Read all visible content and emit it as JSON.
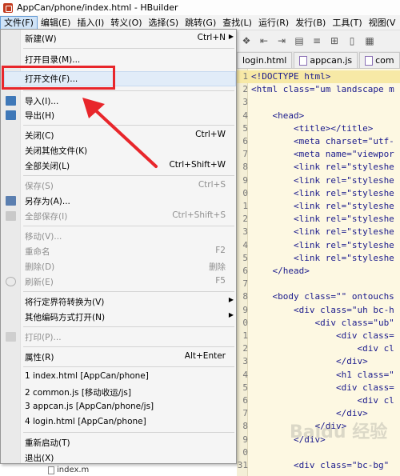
{
  "window": {
    "title": "AppCan/phone/index.html - HBuilder"
  },
  "menubar": [
    "文件(F)",
    "编辑(E)",
    "插入(I)",
    "转义(O)",
    "选择(S)",
    "跳转(G)",
    "查找(L)",
    "运行(R)",
    "发行(B)",
    "工具(T)",
    "视图(V"
  ],
  "tabs": [
    "login.html",
    "appcan.js",
    "com"
  ],
  "menu": {
    "new": {
      "label": "新建(W)",
      "shortcut": "Ctrl+N"
    },
    "open_dir": {
      "label": "打开目录(M)..."
    },
    "open_file": {
      "label": "打开文件(F)..."
    },
    "import": {
      "label": "导入(I)..."
    },
    "export": {
      "label": "导出(H)"
    },
    "close": {
      "label": "关闭(C)",
      "shortcut": "Ctrl+W"
    },
    "close_others": {
      "label": "关闭其他文件(K)"
    },
    "close_all": {
      "label": "全部关闭(L)",
      "shortcut": "Ctrl+Shift+W"
    },
    "save": {
      "label": "保存(S)",
      "shortcut": "Ctrl+S"
    },
    "save_as": {
      "label": "另存为(A)..."
    },
    "save_all": {
      "label": "全部保存(I)",
      "shortcut": "Ctrl+Shift+S"
    },
    "move": {
      "label": "移动(V)..."
    },
    "rename": {
      "label": "重命名",
      "shortcut": "F2"
    },
    "delete": {
      "label": "删除(D)",
      "shortcut": "删除"
    },
    "refresh": {
      "label": "刷新(E)",
      "shortcut": "F5"
    },
    "convert_eol": {
      "label": "将行定界符转换为(V)"
    },
    "open_encoding": {
      "label": "其他编码方式打开(N)"
    },
    "print": {
      "label": "打印(P)..."
    },
    "properties": {
      "label": "属性(R)",
      "shortcut": "Alt+Enter"
    },
    "recent": [
      "1 index.html  [AppCan/phone]",
      "2 common.js  [移动收运/js]",
      "3 appcan.js  [AppCan/phone/js]",
      "4 login.html  [AppCan/phone]"
    ],
    "restart": {
      "label": "重新启动(T)"
    },
    "exit": {
      "label": "退出(X)"
    }
  },
  "sidebar": {
    "file": "index.m"
  },
  "code": {
    "lines": [
      {
        "n": "1",
        "t": "<!DOCTYPE html>"
      },
      {
        "n": "2",
        "t": "<html class=\"um landscape m"
      },
      {
        "n": "3",
        "t": ""
      },
      {
        "n": "4",
        "t": "    <head>"
      },
      {
        "n": "5",
        "t": "        <title></title>"
      },
      {
        "n": "6",
        "t": "        <meta charset=\"utf-"
      },
      {
        "n": "7",
        "t": "        <meta name=\"viewpor"
      },
      {
        "n": "8",
        "t": "        <link rel=\"styleshe"
      },
      {
        "n": "9",
        "t": "        <link rel=\"styleshe"
      },
      {
        "n": "0",
        "t": "        <link rel=\"styleshe"
      },
      {
        "n": "1",
        "t": "        <link rel=\"styleshe"
      },
      {
        "n": "2",
        "t": "        <link rel=\"styleshe"
      },
      {
        "n": "3",
        "t": "        <link rel=\"styleshe"
      },
      {
        "n": "4",
        "t": "        <link rel=\"styleshe"
      },
      {
        "n": "5",
        "t": "        <link rel=\"styleshe"
      },
      {
        "n": "6",
        "t": "    </head>"
      },
      {
        "n": "7",
        "t": ""
      },
      {
        "n": "8",
        "t": "    <body class=\"\" ontouchs"
      },
      {
        "n": "9",
        "t": "        <div class=\"uh bc-h"
      },
      {
        "n": "0",
        "t": "            <div class=\"ub\""
      },
      {
        "n": "1",
        "t": "                <div class="
      },
      {
        "n": "2",
        "t": "                    <div cl"
      },
      {
        "n": "3",
        "t": "                </div>"
      },
      {
        "n": "4",
        "t": "                <h1 class=\""
      },
      {
        "n": "5",
        "t": "                <div class="
      },
      {
        "n": "6",
        "t": "                    <div cl"
      },
      {
        "n": "7",
        "t": "                </div>"
      },
      {
        "n": "8",
        "t": "            </div>"
      },
      {
        "n": "9",
        "t": "        </div>"
      },
      {
        "n": "0",
        "t": ""
      },
      {
        "n": "31",
        "t": "        <div class=\"bc-bg\""
      }
    ]
  },
  "watermark": "Baidu 经验",
  "colors": {
    "highlight_box": "#e8262b",
    "arrow": "#e8262b",
    "editor_bg": "#fdf8e2"
  }
}
